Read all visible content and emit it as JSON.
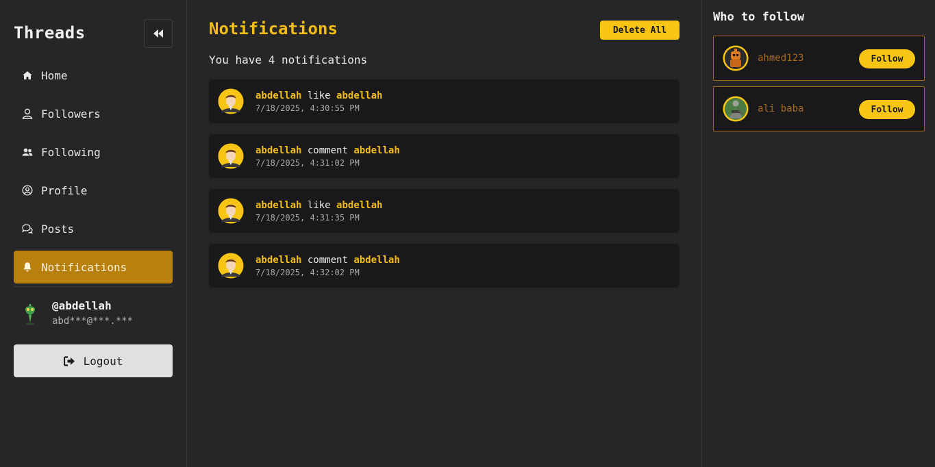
{
  "sidebar": {
    "brand": "Threads",
    "items": [
      {
        "label": "Home",
        "icon": "home-icon"
      },
      {
        "label": "Followers",
        "icon": "user-icon"
      },
      {
        "label": "Following",
        "icon": "users-icon"
      },
      {
        "label": "Profile",
        "icon": "user-circle-icon"
      },
      {
        "label": "Posts",
        "icon": "comments-icon"
      },
      {
        "label": "Notifications",
        "icon": "bell-icon",
        "active": true
      }
    ],
    "user": {
      "handle": "@abdellah",
      "email": "abd***@***.***"
    },
    "logout_label": "Logout"
  },
  "main": {
    "title": "Notifications",
    "delete_all_label": "Delete All",
    "count_text": "You have 4 notifications",
    "notifications": [
      {
        "actor": "abdellah",
        "action": "like",
        "target": "abdellah",
        "time": "7/18/2025, 4:30:55 PM"
      },
      {
        "actor": "abdellah",
        "action": "comment",
        "target": "abdellah",
        "time": "7/18/2025, 4:31:02 PM"
      },
      {
        "actor": "abdellah",
        "action": "like",
        "target": "abdellah",
        "time": "7/18/2025, 4:31:35 PM"
      },
      {
        "actor": "abdellah",
        "action": "comment",
        "target": "abdellah",
        "time": "7/18/2025, 4:32:02 PM"
      }
    ]
  },
  "right": {
    "title": "Who to follow",
    "suggestions": [
      {
        "name": "ahmed123",
        "button": "Follow"
      },
      {
        "name": "ali baba",
        "button": "Follow"
      }
    ]
  },
  "colors": {
    "accent": "#f4bd13",
    "active_nav": "#b8800c",
    "background": "#262628",
    "card": "#19191b"
  }
}
